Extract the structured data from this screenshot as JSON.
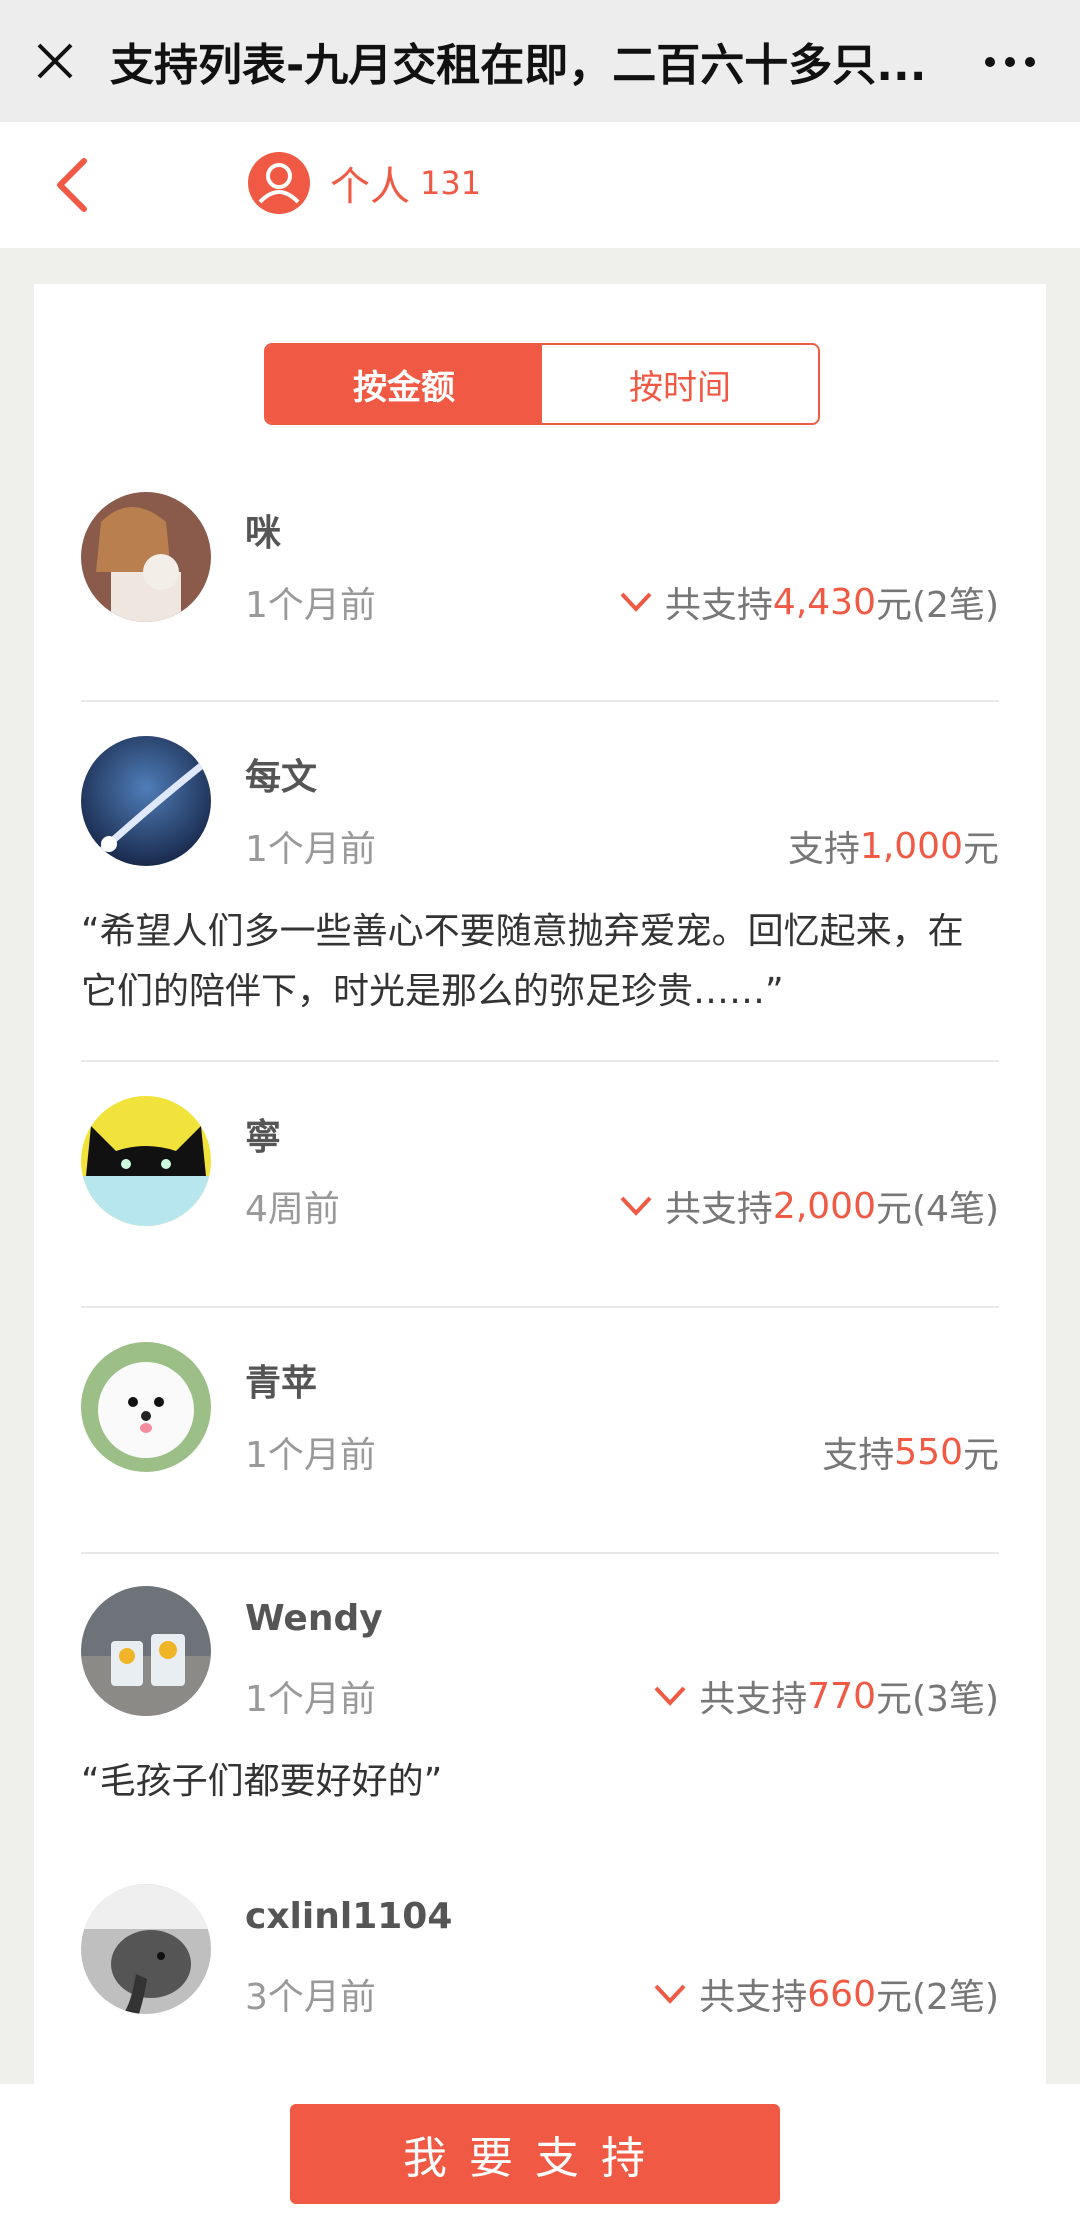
{
  "window": {
    "title": "支持列表-九月交租在即，二百六十多只..."
  },
  "header": {
    "person_label": "个人",
    "person_count": "131"
  },
  "tabs": {
    "by_amount": "按金额",
    "by_time": "按时间"
  },
  "supporters": [
    {
      "name": "咪",
      "time": "1个月前",
      "prefix": "共支持",
      "amount": "4,430",
      "unit": "元",
      "suffix": " (2笔)",
      "expandable": true,
      "comment": ""
    },
    {
      "name": "每文",
      "time": "1个月前",
      "prefix": "支持",
      "amount": "1,000",
      "unit": "元",
      "suffix": "",
      "expandable": false,
      "comment": "“希望人们多一些善心不要随意抛弃爱宠。回忆起来，在它们的陪伴下，时光是那么的弥足珍贵……”"
    },
    {
      "name": "寧",
      "time": "4周前",
      "prefix": "共支持",
      "amount": "2,000",
      "unit": "元",
      "suffix": " (4笔)",
      "expandable": true,
      "comment": ""
    },
    {
      "name": "青苹",
      "time": "1个月前",
      "prefix": "支持",
      "amount": "550",
      "unit": "元",
      "suffix": "",
      "expandable": false,
      "comment": ""
    },
    {
      "name": "Wendy",
      "time": "1个月前",
      "prefix": "共支持",
      "amount": "770",
      "unit": "元",
      "suffix": " (3笔)",
      "expandable": true,
      "comment": "“毛孩子们都要好好的”"
    },
    {
      "name": "cxlinl1104",
      "time": "3个月前",
      "prefix": "共支持",
      "amount": "660",
      "unit": "元",
      "suffix": " (2笔)",
      "expandable": true,
      "comment": ""
    }
  ],
  "bottom": {
    "support_button": "我要支持"
  },
  "colors": {
    "accent": "#f05a45",
    "background": "#efefeb"
  }
}
